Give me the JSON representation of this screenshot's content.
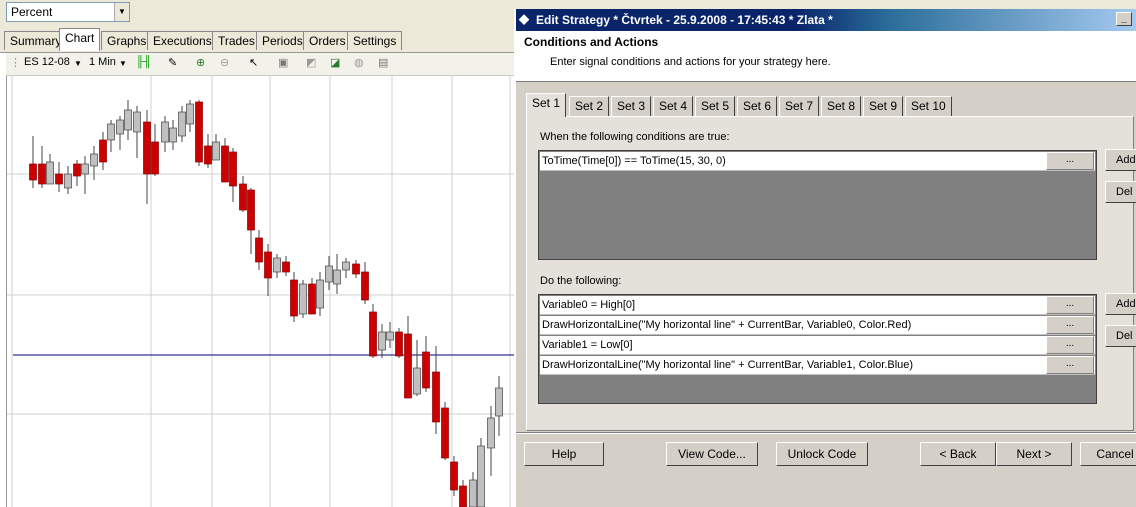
{
  "app": {
    "combo_value": "Percent",
    "tabs": [
      "Summary",
      "Chart",
      "Graphs",
      "Executions",
      "Trades",
      "Periods",
      "Orders",
      "Settings"
    ],
    "active_tab": "Chart",
    "toolbar": {
      "instrument": "ES 12-08",
      "interval": "1 Min"
    }
  },
  "dialog": {
    "title": "Edit Strategy  * Čtvrtek - 25.9.2008 - 17:45:43 * Zlata *",
    "header_title": "Conditions and Actions",
    "header_subtitle": "Enter signal conditions and actions for your strategy here.",
    "set_tabs": [
      "Set 1",
      "Set 2",
      "Set 3",
      "Set 4",
      "Set 5",
      "Set 6",
      "Set 7",
      "Set 8",
      "Set 9",
      "Set 10"
    ],
    "active_set": "Set 1",
    "conditions_label": "When the following conditions are true:",
    "conditions": [
      "ToTime(Time[0]) == ToTime(15, 30, 0)"
    ],
    "actions_label": "Do the following:",
    "actions": [
      "Variable0 = High[0]",
      "DrawHorizontalLine(\"My horizontal line\" + CurrentBar, Variable0, Color.Red)",
      "Variable1 = Low[0]",
      "DrawHorizontalLine(\"My horizontal line\" + CurrentBar, Variable1, Color.Blue)"
    ],
    "ellipsis": "...",
    "add_label": "Add",
    "del_label": "Del",
    "buttons": {
      "help": "Help",
      "view_code": "View Code...",
      "unlock_code": "Unlock Code",
      "back": "< Back",
      "next": "Next >",
      "cancel": "Cancel"
    }
  },
  "colors": {
    "bull": "#c0c0c0",
    "bear": "#cc0000",
    "hline": "#00007f",
    "titlebar": "#0a246a"
  }
}
